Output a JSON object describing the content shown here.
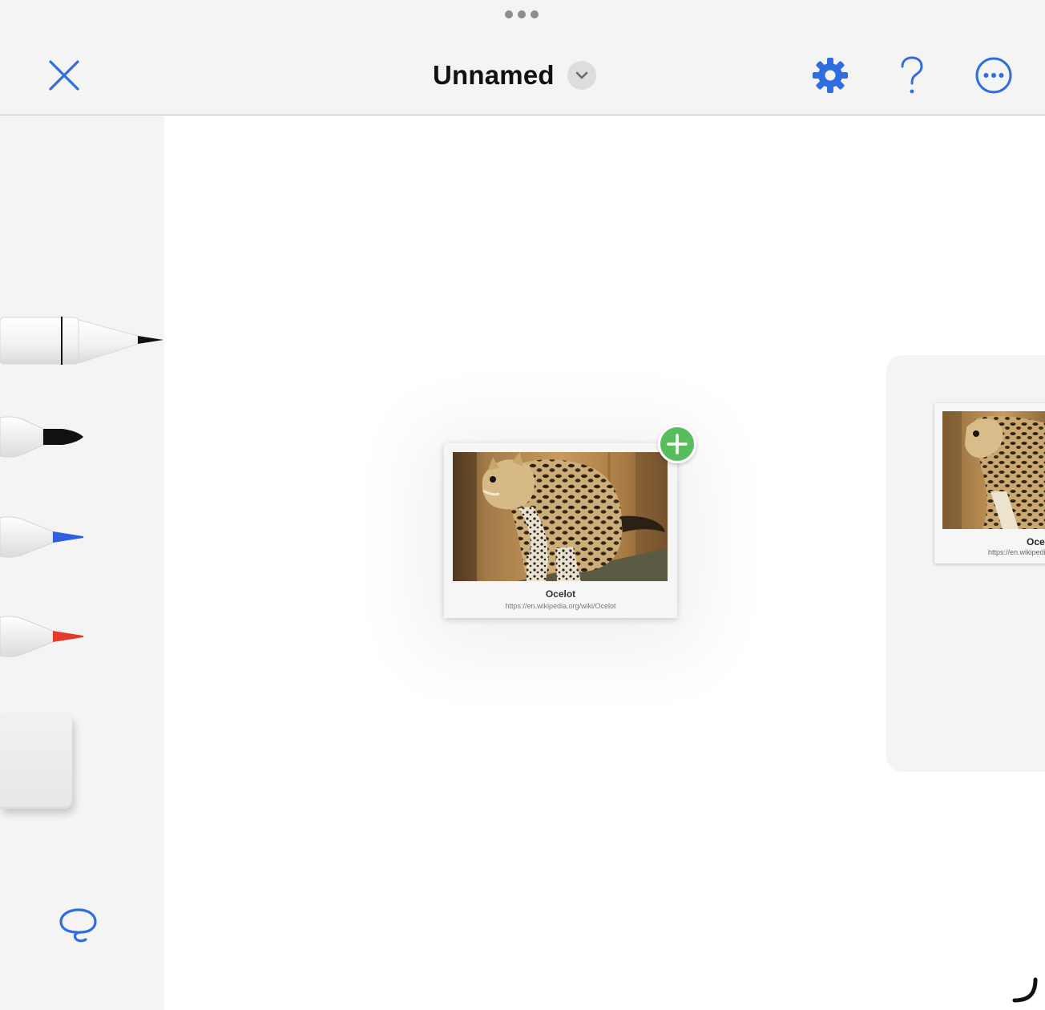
{
  "header": {
    "title": "Unnamed",
    "icons": {
      "grabber": "three-dots-grabber",
      "close": "close-icon",
      "title_menu": "chevron-down-icon",
      "settings": "gear-icon",
      "help": "question-mark-icon",
      "more": "ellipsis-circle-icon"
    }
  },
  "tools": [
    {
      "name": "pencil",
      "color": "#111111"
    },
    {
      "name": "marker-black",
      "color": "#111111"
    },
    {
      "name": "marker-blue",
      "color": "#2f6de1"
    },
    {
      "name": "marker-red",
      "color": "#e53a2b"
    },
    {
      "name": "eraser",
      "color": "#e9e9e9"
    },
    {
      "name": "lasso",
      "color": "#2f6de1"
    }
  ],
  "canvas": {
    "dragged_card": {
      "title": "Ocelot",
      "url": "https://en.wikipedia.org/wiki/Ocelot",
      "add_icon": "plus-circle-icon"
    },
    "side_card": {
      "title": "Oce",
      "url": "https://en.wikipedia"
    }
  },
  "colors": {
    "accent": "#2f6de1",
    "add_badge": "#59bd5e",
    "chrome": "#f4f4f4"
  }
}
